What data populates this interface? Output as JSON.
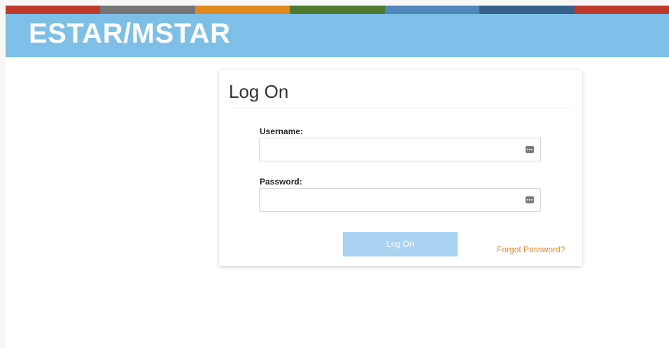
{
  "header": {
    "title": "ESTAR/MSTAR",
    "stripe_colors": [
      "#bf3a2b",
      "#757575",
      "#e08a1e",
      "#4e7a2e",
      "#4f87bd",
      "#365f8c",
      "#bf3a2b"
    ],
    "banner_color": "#7ebfe8"
  },
  "login": {
    "title": "Log On",
    "username_label": "Username:",
    "username_value": "",
    "password_label": "Password:",
    "password_value": "",
    "submit_label": "Log On",
    "forgot_label": "Forgot Password?"
  },
  "icons": {
    "username_field_icon": "password-manager-key-icon",
    "password_field_icon": "password-manager-key-icon"
  },
  "colors": {
    "button": "#a9d3f0",
    "link": "#e8892b"
  }
}
